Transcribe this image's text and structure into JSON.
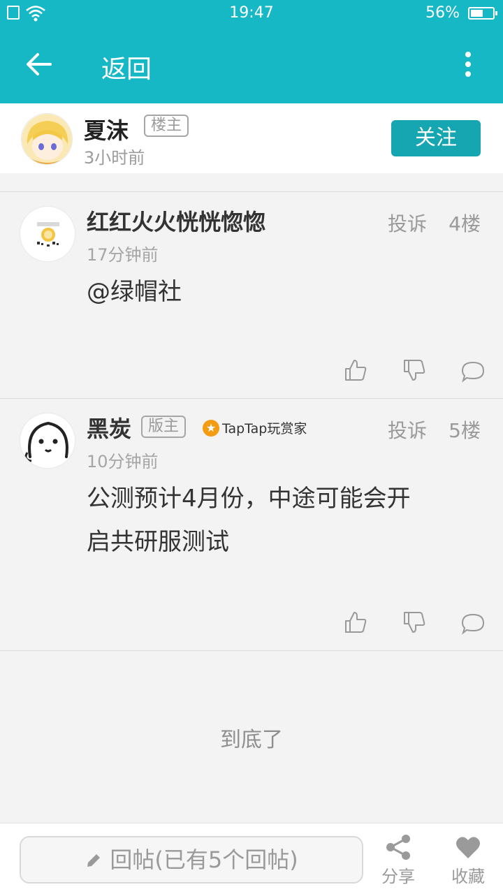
{
  "status_bar": {
    "time": "19:47",
    "battery": "56%",
    "battery_level": 0.56
  },
  "app_bar": {
    "title": "返回",
    "back_icon": "arrow-left-icon",
    "more_icon": "more-vertical-icon"
  },
  "author": {
    "name": "夏沫",
    "tag": "楼主",
    "time": "3小时前",
    "follow_label": "关注"
  },
  "replies": [
    {
      "name": "红红火火恍恍惚惚",
      "time": "17分钟前",
      "report": "投诉",
      "floor": "4楼",
      "body": "@绿帽社"
    },
    {
      "name": "黑炭",
      "tag": "版主",
      "badge": "TapTap玩赏家",
      "time": "10分钟前",
      "report": "投诉",
      "floor": "5楼",
      "body_line1": "公测预计4月份，中途可能会开",
      "body_line2": "启共研服测试"
    }
  ],
  "end_text": "到底了",
  "bottom_bar": {
    "reply_placeholder": "回帖(已有5个回帖)",
    "share_label": "分享",
    "favorite_label": "收藏"
  },
  "colors": {
    "primary": "#16b8c6",
    "follow_button": "#16a6b2",
    "background": "#f3f3f3"
  }
}
